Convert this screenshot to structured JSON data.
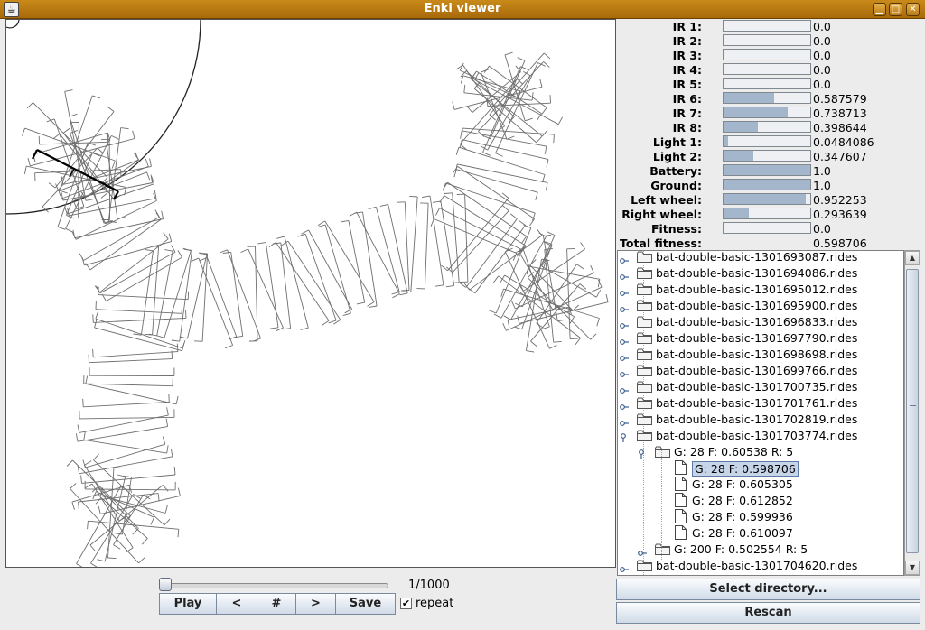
{
  "window": {
    "title": "Enki viewer",
    "icon": "java-app-icon"
  },
  "titlebar_buttons": [
    "minimize-icon",
    "maximize-icon",
    "close-icon"
  ],
  "playback": {
    "slider_fraction": 0.001,
    "frame_counter": "1/1000",
    "buttons": {
      "play": "Play",
      "prev": "<",
      "hash": "#",
      "next": ">",
      "save": "Save"
    },
    "repeat_label": "repeat",
    "repeat_checked": true
  },
  "sensors": [
    {
      "label": "IR 1:",
      "value": "0.0",
      "level": 0.0
    },
    {
      "label": "IR 2:",
      "value": "0.0",
      "level": 0.0
    },
    {
      "label": "IR 3:",
      "value": "0.0",
      "level": 0.0
    },
    {
      "label": "IR 4:",
      "value": "0.0",
      "level": 0.0
    },
    {
      "label": "IR 5:",
      "value": "0.0",
      "level": 0.0
    },
    {
      "label": "IR 6:",
      "value": "0.587579",
      "level": 0.587579
    },
    {
      "label": "IR 7:",
      "value": "0.738713",
      "level": 0.738713
    },
    {
      "label": "IR 8:",
      "value": "0.398644",
      "level": 0.398644
    },
    {
      "label": "Light 1:",
      "value": "0.0484086",
      "level": 0.0484086
    },
    {
      "label": "Light 2:",
      "value": "0.347607",
      "level": 0.347607
    },
    {
      "label": "Battery:",
      "value": "1.0",
      "level": 1.0
    },
    {
      "label": "Ground:",
      "value": "1.0",
      "level": 1.0
    },
    {
      "label": "Left wheel:",
      "value": "0.952253",
      "level": 0.952253
    },
    {
      "label": "Right wheel:",
      "value": "0.293639",
      "level": 0.293639
    },
    {
      "label": "Fitness:",
      "value": "0.0",
      "level": 0.0
    }
  ],
  "total_fitness": {
    "label": "Total fitness:",
    "value": "0.598706"
  },
  "tree": [
    {
      "label": "bat-double-basic-1301693087.rides",
      "kind": "folder",
      "depth": 0,
      "expanded": false
    },
    {
      "label": "bat-double-basic-1301694086.rides",
      "kind": "folder",
      "depth": 0,
      "expanded": false
    },
    {
      "label": "bat-double-basic-1301695012.rides",
      "kind": "folder",
      "depth": 0,
      "expanded": false
    },
    {
      "label": "bat-double-basic-1301695900.rides",
      "kind": "folder",
      "depth": 0,
      "expanded": false
    },
    {
      "label": "bat-double-basic-1301696833.rides",
      "kind": "folder",
      "depth": 0,
      "expanded": false
    },
    {
      "label": "bat-double-basic-1301697790.rides",
      "kind": "folder",
      "depth": 0,
      "expanded": false
    },
    {
      "label": "bat-double-basic-1301698698.rides",
      "kind": "folder",
      "depth": 0,
      "expanded": false
    },
    {
      "label": "bat-double-basic-1301699766.rides",
      "kind": "folder",
      "depth": 0,
      "expanded": false
    },
    {
      "label": "bat-double-basic-1301700735.rides",
      "kind": "folder",
      "depth": 0,
      "expanded": false
    },
    {
      "label": "bat-double-basic-1301701761.rides",
      "kind": "folder",
      "depth": 0,
      "expanded": false
    },
    {
      "label": "bat-double-basic-1301702819.rides",
      "kind": "folder",
      "depth": 0,
      "expanded": false
    },
    {
      "label": "bat-double-basic-1301703774.rides",
      "kind": "folder",
      "depth": 0,
      "expanded": true
    },
    {
      "label": "G: 28 F: 0.60538 R: 5",
      "kind": "folder",
      "depth": 1,
      "expanded": true
    },
    {
      "label": "G: 28 F: 0.598706",
      "kind": "file",
      "depth": 2,
      "selected": true
    },
    {
      "label": "G: 28 F: 0.605305",
      "kind": "file",
      "depth": 2
    },
    {
      "label": "G: 28 F: 0.612852",
      "kind": "file",
      "depth": 2
    },
    {
      "label": "G: 28 F: 0.599936",
      "kind": "file",
      "depth": 2
    },
    {
      "label": "G: 28 F: 0.610097",
      "kind": "file",
      "depth": 2
    },
    {
      "label": "G: 200 F: 0.502554 R: 5",
      "kind": "folder",
      "depth": 1,
      "expanded": false
    },
    {
      "label": "bat-double-basic-1301704620.rides",
      "kind": "folder",
      "depth": 0,
      "expanded": false
    }
  ],
  "actions": {
    "select_directory": "Select directory...",
    "rescan": "Rescan"
  },
  "colors": {
    "titlebar": "#b87a12",
    "bar_fill": "#a3b6cc",
    "trail": "#6e6e6e",
    "selection": "#c6d5e8"
  }
}
